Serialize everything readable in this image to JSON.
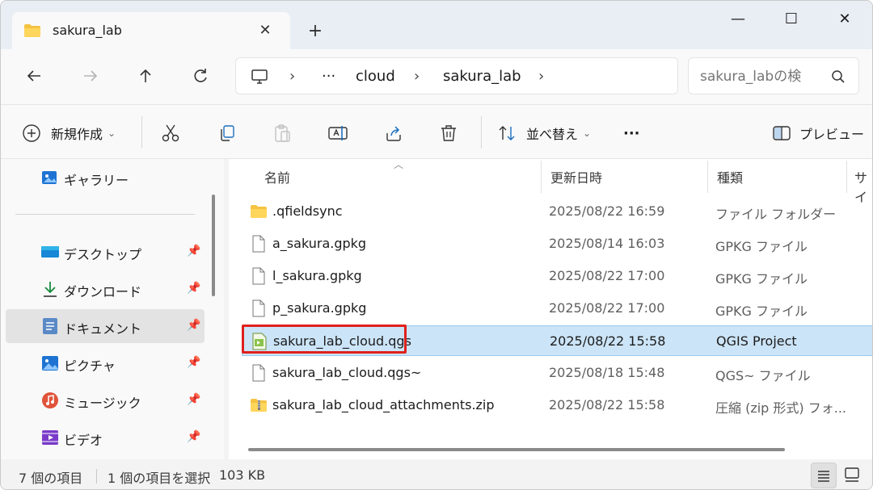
{
  "tab": {
    "title": "sakura_lab",
    "close_icon": "close-icon",
    "new_tab_label": "+"
  },
  "window_controls": {
    "minimize": "—",
    "maximize": "☐",
    "close": "✕"
  },
  "address": {
    "crumbs": [
      "cloud",
      "sakura_lab"
    ],
    "overflow": "···",
    "sep": "›"
  },
  "search": {
    "placeholder": "sakura_labの検"
  },
  "commands": {
    "new": "新規作成",
    "sort": "並べ替え",
    "more": "···",
    "preview": "プレビュー"
  },
  "sidebar": {
    "items": [
      {
        "label": "ギャラリー",
        "icon": "gallery-icon"
      },
      {
        "label": "デスクトップ",
        "icon": "desktop-icon"
      },
      {
        "label": "ダウンロード",
        "icon": "download-icon"
      },
      {
        "label": "ドキュメント",
        "icon": "document-icon"
      },
      {
        "label": "ピクチャ",
        "icon": "picture-icon"
      },
      {
        "label": "ミュージック",
        "icon": "music-icon"
      },
      {
        "label": "ビデオ",
        "icon": "video-icon"
      }
    ]
  },
  "columns": {
    "name": "名前",
    "date": "更新日時",
    "type": "種類",
    "size": "サイ"
  },
  "files": [
    {
      "name": ".qfieldsync",
      "date": "2025/08/22 16:59",
      "type": "ファイル フォルダー",
      "icon": "folder-icon"
    },
    {
      "name": "a_sakura.gpkg",
      "date": "2025/08/14 16:03",
      "type": "GPKG ファイル",
      "icon": "file-icon"
    },
    {
      "name": "l_sakura.gpkg",
      "date": "2025/08/22 17:00",
      "type": "GPKG ファイル",
      "icon": "file-icon"
    },
    {
      "name": "p_sakura.gpkg",
      "date": "2025/08/22 17:00",
      "type": "GPKG ファイル",
      "icon": "file-icon"
    },
    {
      "name": "sakura_lab_cloud.qgs",
      "date": "2025/08/22 15:58",
      "type": "QGIS Project",
      "icon": "qgis-project-icon"
    },
    {
      "name": "sakura_lab_cloud.qgs~",
      "date": "2025/08/18 15:48",
      "type": "QGS~ ファイル",
      "icon": "file-icon"
    },
    {
      "name": "sakura_lab_cloud_attachments.zip",
      "date": "2025/08/22 15:58",
      "type": "圧縮 (zip 形式) フォ...",
      "icon": "zip-folder-icon"
    }
  ],
  "status": {
    "count": "7 個の項目",
    "selected": "1 個の項目を選択",
    "size": "103 KB"
  },
  "colors": {
    "accent": "#0067c0",
    "selection": "#cce4f7",
    "highlight": "#e0201c"
  }
}
